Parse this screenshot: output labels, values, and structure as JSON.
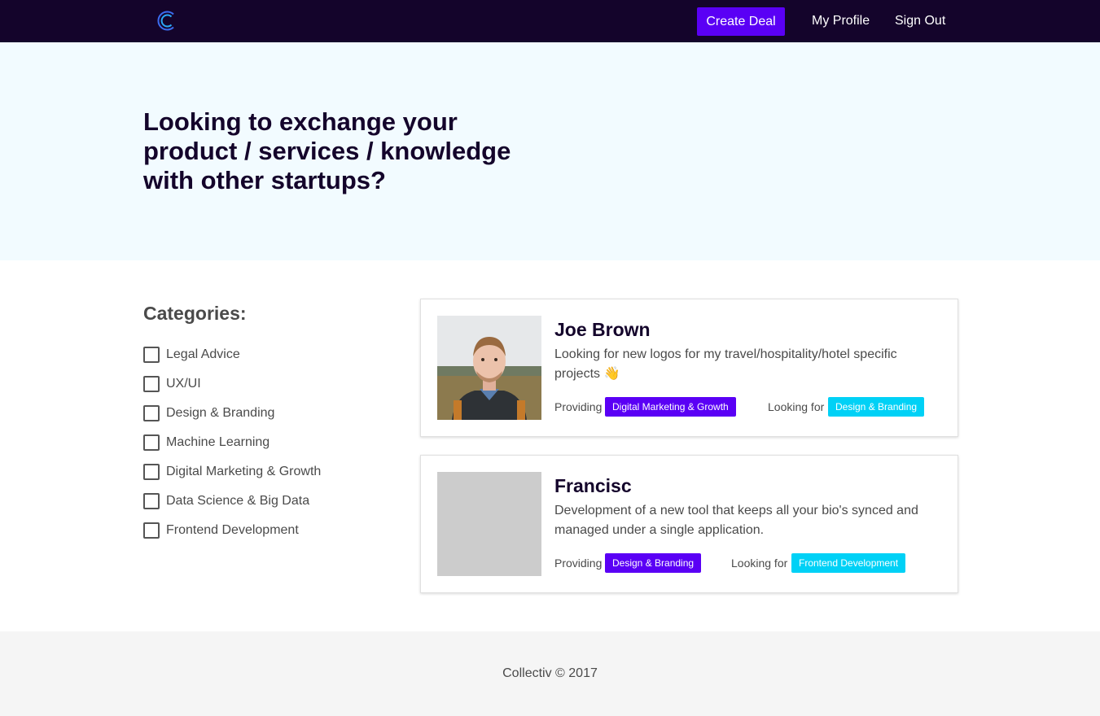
{
  "nav": {
    "logo_icon": "collectiv-logo-icon",
    "create_deal": "Create Deal",
    "my_profile": "My Profile",
    "sign_out": "Sign Out"
  },
  "hero": {
    "title": "Looking to exchange your product / services / knowledge with other startups?"
  },
  "categories": {
    "title": "Categories:",
    "items": [
      "Legal Advice",
      "UX/UI",
      "Design & Branding",
      "Machine Learning",
      "Digital Marketing & Growth",
      "Data Science & Big Data",
      "Frontend Development"
    ]
  },
  "deals": [
    {
      "name": "Joe Brown",
      "description": "Looking for new logos for my travel/hospitality/hotel specific projects 👋",
      "providing_label": "Providing",
      "providing": "Digital Marketing & Growth",
      "looking_label": "Looking for",
      "looking": "Design & Branding"
    },
    {
      "name": "Francisc",
      "description": "Development of a new tool that keeps all your bio's synced and managed under a single application.",
      "providing_label": "Providing",
      "providing": "Design & Branding",
      "looking_label": "Looking for",
      "looking": "Frontend Development"
    }
  ],
  "footer": {
    "text": "Collectiv © 2017"
  },
  "colors": {
    "nav_bg": "#14042b",
    "accent": "#5a00f5",
    "looking_tag": "#00d1f6",
    "hero_bg": "#f2fbff",
    "footer_bg": "#f5f5f5"
  }
}
